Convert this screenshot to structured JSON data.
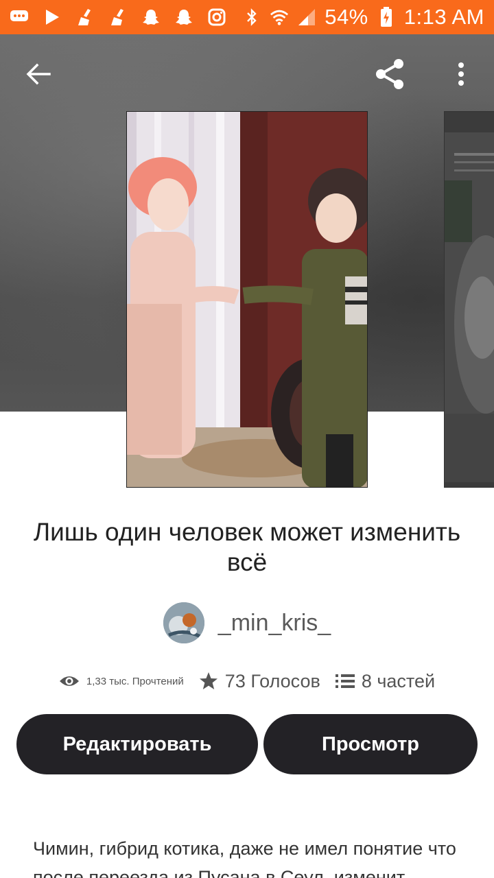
{
  "status_bar": {
    "battery": "54%",
    "time": "1:13 AM",
    "accent_color": "#f96a1b",
    "icons": [
      "chat-bubble-icon",
      "play-store-icon",
      "clean-broom-icon",
      "clean-broom-icon",
      "snapchat-icon",
      "snapchat-icon",
      "instagram-icon",
      "bluetooth-icon",
      "wifi-icon",
      "signal-icon",
      "battery-charging-icon"
    ]
  },
  "toolbar": {
    "back_icon": "arrow-left-icon",
    "share_icon": "share-icon",
    "more_icon": "more-vertical-icon"
  },
  "story": {
    "title": "Лишь один человек может изменить всё",
    "author": "_min_kris_",
    "stats": {
      "reads": "1,33 тыс. Прочтений",
      "votes": "73 Голосов",
      "parts": "8 частей"
    },
    "buttons": {
      "edit": "Редактировать",
      "view": "Просмотр"
    },
    "description": "Чимин, гибрид котика, даже не имел понятие что после переезда из Пусана в Сеул, изменит"
  }
}
